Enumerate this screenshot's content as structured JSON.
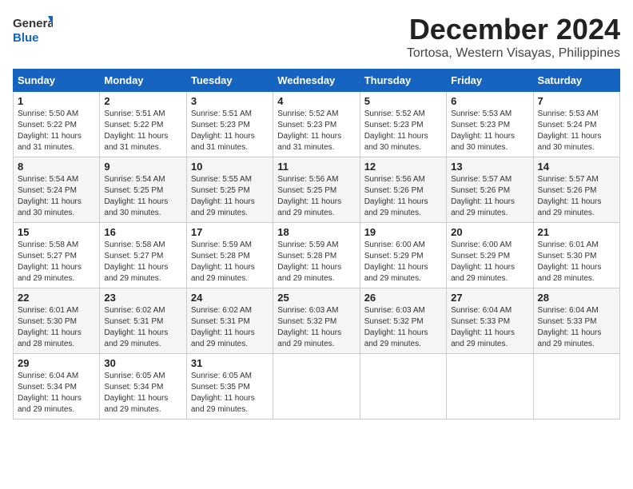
{
  "logo": {
    "line1": "General",
    "line2": "Blue"
  },
  "title": "December 2024",
  "location": "Tortosa, Western Visayas, Philippines",
  "headers": [
    "Sunday",
    "Monday",
    "Tuesday",
    "Wednesday",
    "Thursday",
    "Friday",
    "Saturday"
  ],
  "weeks": [
    [
      {
        "day": "1",
        "sunrise": "5:50 AM",
        "sunset": "5:22 PM",
        "daylight": "11 hours and 31 minutes."
      },
      {
        "day": "2",
        "sunrise": "5:51 AM",
        "sunset": "5:22 PM",
        "daylight": "11 hours and 31 minutes."
      },
      {
        "day": "3",
        "sunrise": "5:51 AM",
        "sunset": "5:23 PM",
        "daylight": "11 hours and 31 minutes."
      },
      {
        "day": "4",
        "sunrise": "5:52 AM",
        "sunset": "5:23 PM",
        "daylight": "11 hours and 31 minutes."
      },
      {
        "day": "5",
        "sunrise": "5:52 AM",
        "sunset": "5:23 PM",
        "daylight": "11 hours and 30 minutes."
      },
      {
        "day": "6",
        "sunrise": "5:53 AM",
        "sunset": "5:23 PM",
        "daylight": "11 hours and 30 minutes."
      },
      {
        "day": "7",
        "sunrise": "5:53 AM",
        "sunset": "5:24 PM",
        "daylight": "11 hours and 30 minutes."
      }
    ],
    [
      {
        "day": "8",
        "sunrise": "5:54 AM",
        "sunset": "5:24 PM",
        "daylight": "11 hours and 30 minutes."
      },
      {
        "day": "9",
        "sunrise": "5:54 AM",
        "sunset": "5:25 PM",
        "daylight": "11 hours and 30 minutes."
      },
      {
        "day": "10",
        "sunrise": "5:55 AM",
        "sunset": "5:25 PM",
        "daylight": "11 hours and 29 minutes."
      },
      {
        "day": "11",
        "sunrise": "5:56 AM",
        "sunset": "5:25 PM",
        "daylight": "11 hours and 29 minutes."
      },
      {
        "day": "12",
        "sunrise": "5:56 AM",
        "sunset": "5:26 PM",
        "daylight": "11 hours and 29 minutes."
      },
      {
        "day": "13",
        "sunrise": "5:57 AM",
        "sunset": "5:26 PM",
        "daylight": "11 hours and 29 minutes."
      },
      {
        "day": "14",
        "sunrise": "5:57 AM",
        "sunset": "5:26 PM",
        "daylight": "11 hours and 29 minutes."
      }
    ],
    [
      {
        "day": "15",
        "sunrise": "5:58 AM",
        "sunset": "5:27 PM",
        "daylight": "11 hours and 29 minutes."
      },
      {
        "day": "16",
        "sunrise": "5:58 AM",
        "sunset": "5:27 PM",
        "daylight": "11 hours and 29 minutes."
      },
      {
        "day": "17",
        "sunrise": "5:59 AM",
        "sunset": "5:28 PM",
        "daylight": "11 hours and 29 minutes."
      },
      {
        "day": "18",
        "sunrise": "5:59 AM",
        "sunset": "5:28 PM",
        "daylight": "11 hours and 29 minutes."
      },
      {
        "day": "19",
        "sunrise": "6:00 AM",
        "sunset": "5:29 PM",
        "daylight": "11 hours and 29 minutes."
      },
      {
        "day": "20",
        "sunrise": "6:00 AM",
        "sunset": "5:29 PM",
        "daylight": "11 hours and 29 minutes."
      },
      {
        "day": "21",
        "sunrise": "6:01 AM",
        "sunset": "5:30 PM",
        "daylight": "11 hours and 28 minutes."
      }
    ],
    [
      {
        "day": "22",
        "sunrise": "6:01 AM",
        "sunset": "5:30 PM",
        "daylight": "11 hours and 28 minutes."
      },
      {
        "day": "23",
        "sunrise": "6:02 AM",
        "sunset": "5:31 PM",
        "daylight": "11 hours and 29 minutes."
      },
      {
        "day": "24",
        "sunrise": "6:02 AM",
        "sunset": "5:31 PM",
        "daylight": "11 hours and 29 minutes."
      },
      {
        "day": "25",
        "sunrise": "6:03 AM",
        "sunset": "5:32 PM",
        "daylight": "11 hours and 29 minutes."
      },
      {
        "day": "26",
        "sunrise": "6:03 AM",
        "sunset": "5:32 PM",
        "daylight": "11 hours and 29 minutes."
      },
      {
        "day": "27",
        "sunrise": "6:04 AM",
        "sunset": "5:33 PM",
        "daylight": "11 hours and 29 minutes."
      },
      {
        "day": "28",
        "sunrise": "6:04 AM",
        "sunset": "5:33 PM",
        "daylight": "11 hours and 29 minutes."
      }
    ],
    [
      {
        "day": "29",
        "sunrise": "6:04 AM",
        "sunset": "5:34 PM",
        "daylight": "11 hours and 29 minutes."
      },
      {
        "day": "30",
        "sunrise": "6:05 AM",
        "sunset": "5:34 PM",
        "daylight": "11 hours and 29 minutes."
      },
      {
        "day": "31",
        "sunrise": "6:05 AM",
        "sunset": "5:35 PM",
        "daylight": "11 hours and 29 minutes."
      },
      null,
      null,
      null,
      null
    ]
  ]
}
